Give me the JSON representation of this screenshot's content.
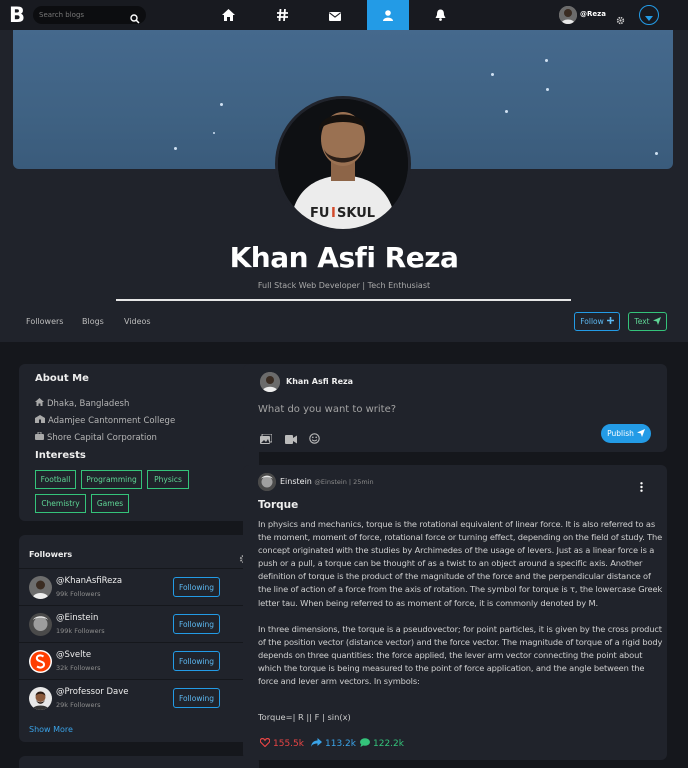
{
  "nav": {
    "logo": "B",
    "search_placeholder": "Search blogs",
    "tabs": [
      "home-icon",
      "hashtag-icon",
      "mail-icon",
      "user-icon",
      "bell-icon"
    ],
    "active_tab": "user-icon",
    "user_handle": "@Reza",
    "accent": "#239be6"
  },
  "profile": {
    "name": "Khan Asfi Reza",
    "tagline": "Full Stack Web Developer | Tech Enthusiast",
    "tabs": [
      "Followers",
      "Blogs",
      "Videos"
    ],
    "follow_label": "Follow",
    "text_label": "Text"
  },
  "about": {
    "title": "About Me",
    "location": "Dhaka, Bangladesh",
    "education": "Adamjee Cantonment College",
    "work": "Shore Capital Corporation",
    "interests_title": "Interests",
    "interests": [
      "Football",
      "Programming",
      "Physics",
      "Chemistry",
      "Games"
    ]
  },
  "followers": {
    "title": "Followers",
    "items": [
      {
        "name": "@KhanAsfiReza",
        "count": "99k Followers",
        "button": "Following"
      },
      {
        "name": "@Einstein",
        "count": "199k Followers",
        "button": "Following"
      },
      {
        "name": "@Svelte",
        "count": "32k Followers",
        "button": "Following"
      },
      {
        "name": "@Professor Dave",
        "count": "29k Followers",
        "button": "Following"
      }
    ],
    "show_more": "Show More"
  },
  "composer": {
    "author": "Khan Asfi Reza",
    "placeholder": "What do you want to write?",
    "publish_label": "Publish"
  },
  "post": {
    "author": "Einstein",
    "meta": "@Einstein | 25min",
    "title": "Torque",
    "paragraph1": "In physics and mechanics, torque is the rotational equivalent of linear force. It is also referred to as the moment, moment of force, rotational force or turning effect, depending on the field of study. The concept originated with the studies by Archimedes of the usage of levers. Just as a linear force is a push or a pull, a torque can be thought of as a twist to an object around a specific axis. Another definition of torque is the product of the magnitude of the force and the perpendicular distance of the line of action of a force from the axis of rotation. The symbol for torque is τ, the lowercase Greek letter tau. When being referred to as moment of force, it is commonly denoted by M.",
    "paragraph2": "In three dimensions, the torque is a pseudovector; for point particles, it is given by the cross product of the position vector (distance vector) and the force vector. The magnitude of torque of a rigid body depends on three quantities: the force applied, the lever arm vector connecting the point about which the torque is being measured to the point of force application, and the angle between the force and lever arm vectors. In symbols:",
    "formula": "Torque=| R || F | sin(x)",
    "likes": "155.5k",
    "shares": "113.2k",
    "comments": "122.2k",
    "like_color": "#e84545",
    "share_color": "#3aa3e8",
    "comment_color": "#34c37a"
  }
}
